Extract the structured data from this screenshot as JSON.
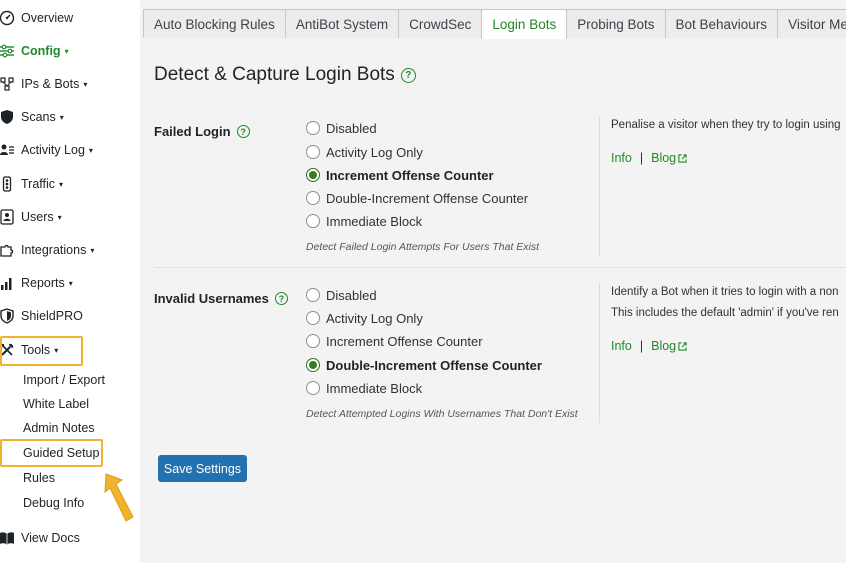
{
  "sidebar": {
    "items": [
      {
        "label": "Overview",
        "icon": "dashboard-gauge-icon"
      },
      {
        "label": "Config",
        "icon": "sliders-icon",
        "caret": "▾"
      },
      {
        "label": "IPs & Bots",
        "icon": "network-nodes-icon",
        "caret": "▾"
      },
      {
        "label": "Scans",
        "icon": "shield-icon",
        "caret": "▾"
      },
      {
        "label": "Activity Log",
        "icon": "person-list-icon",
        "caret": "▾"
      },
      {
        "label": "Traffic",
        "icon": "traffic-light-icon",
        "caret": "▾"
      },
      {
        "label": "Users",
        "icon": "user-card-icon",
        "caret": "▾"
      },
      {
        "label": "Integrations",
        "icon": "puzzle-icon",
        "caret": "▾"
      },
      {
        "label": "Reports",
        "icon": "bar-chart-icon",
        "caret": "▾"
      },
      {
        "label": "ShieldPRO",
        "icon": "shield-pro-icon"
      },
      {
        "label": "Tools",
        "icon": "tools-icon",
        "caret": "▾"
      }
    ],
    "tools_submenu": [
      "Import / Export",
      "White Label",
      "Admin Notes",
      "Guided Setup",
      "Rules",
      "Debug Info"
    ],
    "view_docs": {
      "label": "View Docs",
      "icon": "book-icon"
    }
  },
  "tabs": [
    "Auto Blocking Rules",
    "AntiBot System",
    "CrowdSec",
    "Login Bots",
    "Probing Bots",
    "Bot Behaviours",
    "Visitor Messa"
  ],
  "active_tab": "Login Bots",
  "page": {
    "title": "Detect & Capture Login Bots"
  },
  "sections": [
    {
      "label": "Failed Login",
      "options": [
        "Disabled",
        "Activity Log Only",
        "Increment Offense Counter",
        "Double-Increment Offense Counter",
        "Immediate Block"
      ],
      "selected": "Increment Offense Counter",
      "note": "Detect Failed Login Attempts For Users That Exist",
      "desc_lines": [
        "Penalise a visitor when they try to login using"
      ],
      "info_label": "Info",
      "blog_label": "Blog"
    },
    {
      "label": "Invalid Usernames",
      "options": [
        "Disabled",
        "Activity Log Only",
        "Increment Offense Counter",
        "Double-Increment Offense Counter",
        "Immediate Block"
      ],
      "selected": "Double-Increment Offense Counter",
      "note": "Detect Attempted Logins With Usernames That Don't Exist",
      "desc_lines": [
        "Identify a Bot when it tries to login with a non",
        "This includes the default 'admin' if you've ren"
      ],
      "info_label": "Info",
      "blog_label": "Blog"
    }
  ],
  "save_button": "Save Settings",
  "colors": {
    "accent_green": "#1f8a26",
    "button_blue": "#2271b1",
    "highlight_orange": "#f0b32e"
  }
}
